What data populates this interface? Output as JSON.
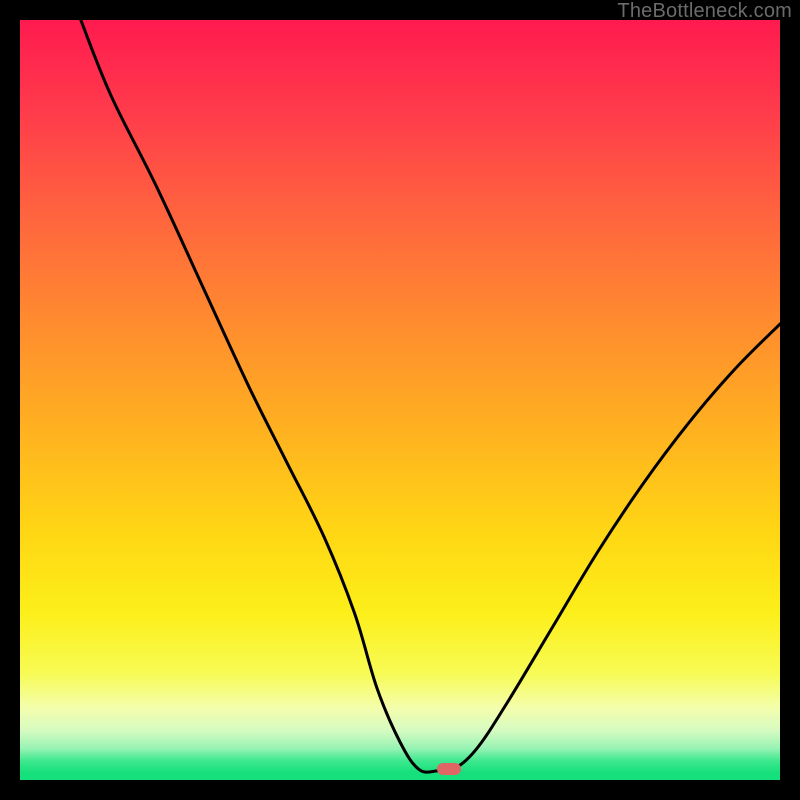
{
  "watermark": "TheBottleneck.com",
  "marker": {
    "color": "#e06666",
    "x_frac": 0.565,
    "y_frac": 0.985
  },
  "gradient_stops": [
    {
      "offset": 0.0,
      "color": "#ff1a4f"
    },
    {
      "offset": 0.12,
      "color": "#ff3b4b"
    },
    {
      "offset": 0.25,
      "color": "#ff623f"
    },
    {
      "offset": 0.4,
      "color": "#ff8c2e"
    },
    {
      "offset": 0.55,
      "color": "#ffb41f"
    },
    {
      "offset": 0.68,
      "color": "#ffd814"
    },
    {
      "offset": 0.78,
      "color": "#fcef1a"
    },
    {
      "offset": 0.86,
      "color": "#f7fb55"
    },
    {
      "offset": 0.905,
      "color": "#f4feac"
    },
    {
      "offset": 0.935,
      "color": "#d6fbc1"
    },
    {
      "offset": 0.958,
      "color": "#98f3b4"
    },
    {
      "offset": 0.975,
      "color": "#3de88e"
    },
    {
      "offset": 0.99,
      "color": "#16e07c"
    },
    {
      "offset": 1.0,
      "color": "#16e07c"
    }
  ],
  "chart_data": {
    "type": "line",
    "title": "",
    "xlabel": "",
    "ylabel": "",
    "xlim": [
      0,
      100
    ],
    "ylim": [
      0,
      100
    ],
    "series": [
      {
        "name": "bottleneck-curve",
        "x": [
          8,
          12,
          18,
          24,
          30,
          35,
          40,
          44,
          47,
          50,
          52.5,
          55,
          57,
          60,
          64,
          70,
          76,
          82,
          88,
          94,
          100
        ],
        "y": [
          100,
          90,
          78,
          65,
          52,
          42,
          32,
          22,
          12,
          5,
          1.4,
          1.2,
          1.4,
          4,
          10,
          20,
          30,
          39,
          47,
          54,
          60
        ]
      }
    ],
    "flat_segment": {
      "x_start": 52.5,
      "x_end": 57,
      "y": 1.3
    },
    "marker_point": {
      "x": 56.5,
      "y": 1.3
    }
  }
}
